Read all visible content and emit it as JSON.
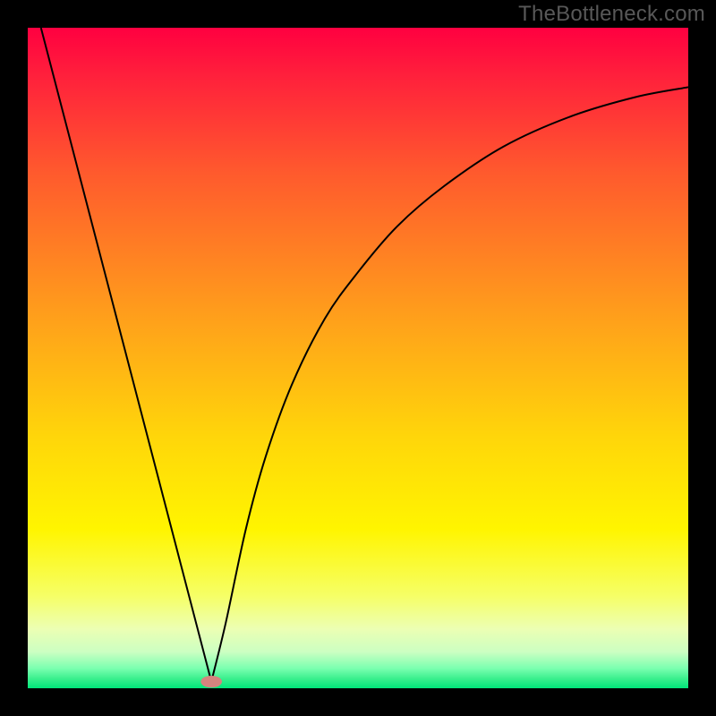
{
  "watermark": "TheBottleneck.com",
  "colors": {
    "frame": "#000000",
    "curve_stroke": "#000000",
    "marker_fill": "#d6847e",
    "gradient_stops": [
      {
        "offset": 0.0,
        "color": "#ff0040"
      },
      {
        "offset": 0.07,
        "color": "#ff1f3c"
      },
      {
        "offset": 0.22,
        "color": "#ff5a2d"
      },
      {
        "offset": 0.45,
        "color": "#ffa31a"
      },
      {
        "offset": 0.62,
        "color": "#ffd60a"
      },
      {
        "offset": 0.76,
        "color": "#fff500"
      },
      {
        "offset": 0.86,
        "color": "#f6ff66"
      },
      {
        "offset": 0.91,
        "color": "#ecffb3"
      },
      {
        "offset": 0.945,
        "color": "#ccffc2"
      },
      {
        "offset": 0.97,
        "color": "#7affb0"
      },
      {
        "offset": 0.985,
        "color": "#3cf08e"
      },
      {
        "offset": 1.0,
        "color": "#00e67a"
      }
    ]
  },
  "chart_data": {
    "type": "line",
    "title": "",
    "xlabel": "",
    "ylabel": "",
    "xlim": [
      0,
      100
    ],
    "ylim": [
      0,
      100
    ],
    "series": [
      {
        "name": "left-descent",
        "x": [
          2,
          27.8
        ],
        "y": [
          100,
          1
        ]
      },
      {
        "name": "right-ascent",
        "x": [
          27.8,
          30,
          33,
          36,
          40,
          45,
          50,
          56,
          63,
          72,
          82,
          92,
          100
        ],
        "y": [
          1,
          10,
          24,
          35,
          46,
          56,
          63,
          70,
          76,
          82,
          86.5,
          89.5,
          91
        ]
      }
    ],
    "marker": {
      "name": "minimum",
      "x": 27.8,
      "y": 1,
      "rx": 1.6,
      "ry": 0.9
    }
  }
}
